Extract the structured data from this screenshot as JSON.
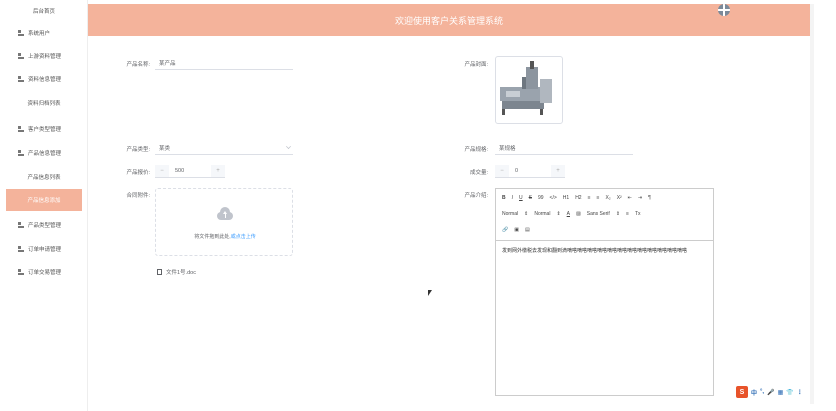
{
  "sidebar": {
    "items": [
      {
        "label": "后台首页",
        "icon": "none"
      },
      {
        "label": "系统用户",
        "icon": "grid-icon"
      },
      {
        "label": "上游资料管理",
        "icon": "grid-icon"
      },
      {
        "label": "资料信息管理",
        "icon": "grid-icon"
      },
      {
        "label": "资料归档列表",
        "icon": "none"
      },
      {
        "label": "客户类型管理",
        "icon": "grid-icon"
      },
      {
        "label": "产品信息管理",
        "icon": "grid-icon"
      },
      {
        "label": "产品信息列表",
        "icon": "none"
      },
      {
        "label": "产品信息添加",
        "icon": "none",
        "active": true
      },
      {
        "label": "产品类型管理",
        "icon": "grid-icon"
      },
      {
        "label": "订单申请管理",
        "icon": "grid-icon"
      },
      {
        "label": "订单交易管理",
        "icon": "grid-icon"
      }
    ]
  },
  "header": {
    "title": "欢迎使用客户关系管理系统"
  },
  "form": {
    "name_label": "产品名称:",
    "name_value": "某产品",
    "cover_label": "产品封面:",
    "type_label": "产品类型:",
    "type_value": "某类",
    "spec_label": "产品规格:",
    "spec_value": "某规格",
    "price_label": "产品报价:",
    "price_value": "500",
    "deal_label": "成交量:",
    "deal_value": "0",
    "attach_label": "合同附件:",
    "intro_label": "产品介绍:"
  },
  "upload": {
    "text": "将文件拖到此处,",
    "link": "或点击上传",
    "file_name": "文件1号.doc"
  },
  "editor": {
    "toolbar_row1": [
      "B",
      "I",
      "U",
      "S",
      "99",
      "</>",
      "H1",
      "H2",
      "≡",
      "≡",
      "X₂",
      "X²",
      "⇤",
      "⇥",
      "¶"
    ],
    "toolbar_row2": [
      "Normal",
      "⇕",
      "Normal",
      "⇕",
      "A",
      "▨",
      "Sans Serif",
      "⇕",
      "≡",
      "Tx"
    ],
    "toolbar_row3": [
      "🔗",
      "▣",
      "▤"
    ],
    "content": "发到网外缴税去发现和翻到滴嘀嗒嘀嗒嘀嗒嘀嗒嘀嗒嘀嗒嘀嗒嘀嗒嘀嗒嘀嗒嘀嗒嘀嗒"
  },
  "ime": {
    "items": [
      "中",
      "°,",
      "🎤",
      "▦",
      "👕",
      "⋮"
    ]
  },
  "colors": {
    "accent": "#f4b39b",
    "link": "#409eff"
  }
}
